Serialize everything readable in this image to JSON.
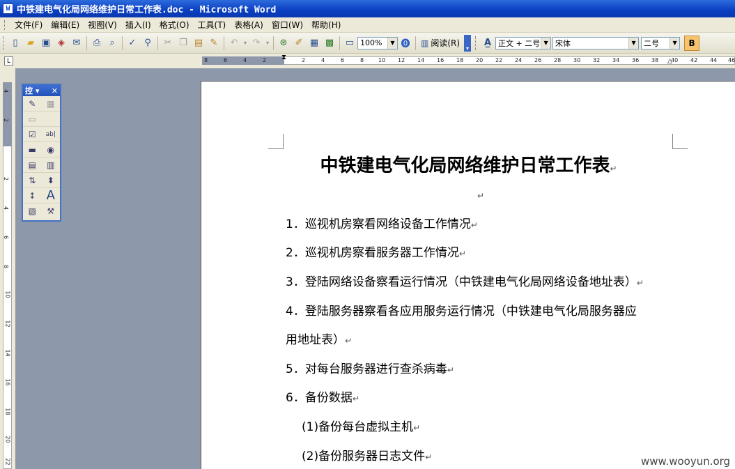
{
  "window": {
    "title": "中铁建电气化局网络维护日常工作表.doc - Microsoft Word",
    "app_icon": "W"
  },
  "menu": [
    "文件(F)",
    "编辑(E)",
    "视图(V)",
    "插入(I)",
    "格式(O)",
    "工具(T)",
    "表格(A)",
    "窗口(W)",
    "帮助(H)"
  ],
  "toolbar": {
    "zoom": "100%",
    "read_label": "阅读(R)",
    "style": "正文 + 二号",
    "font": "宋体",
    "size": "二号",
    "bold": "B"
  },
  "control_toolbox": {
    "title": "控",
    "close": "✕"
  },
  "ruler": {
    "h_numbers_left": [
      "8",
      "6",
      "4",
      "2"
    ],
    "h_numbers_right": [
      "2",
      "4",
      "6",
      "8",
      "10",
      "12",
      "14",
      "16",
      "18",
      "20",
      "22",
      "24",
      "26",
      "28",
      "30",
      "32",
      "34",
      "36",
      "38",
      "40",
      "42",
      "44",
      "46"
    ],
    "v_numbers": [
      "4",
      "2",
      "2",
      "4",
      "6",
      "8",
      "10",
      "12",
      "14",
      "16",
      "18",
      "20",
      "22"
    ]
  },
  "document": {
    "title": "中铁建电气化局网络维护日常工作表",
    "paragraph_mark": "↵",
    "items": [
      "1．巡视机房察看网络设备工作情况",
      "2．巡视机房察看服务器工作情况",
      "3．登陆网络设备察看运行情况（中铁建电气化局网络设备地址表）",
      "4．登陆服务器察看各应用服务运行情况（中铁建电气化局服务器应",
      "用地址表）",
      "5．对每台服务器进行查杀病毒",
      "6．备份数据",
      "(1)备份每台虚拟主机",
      "(2)备份服务器日志文件"
    ]
  },
  "watermark": "www.wooyun.org"
}
